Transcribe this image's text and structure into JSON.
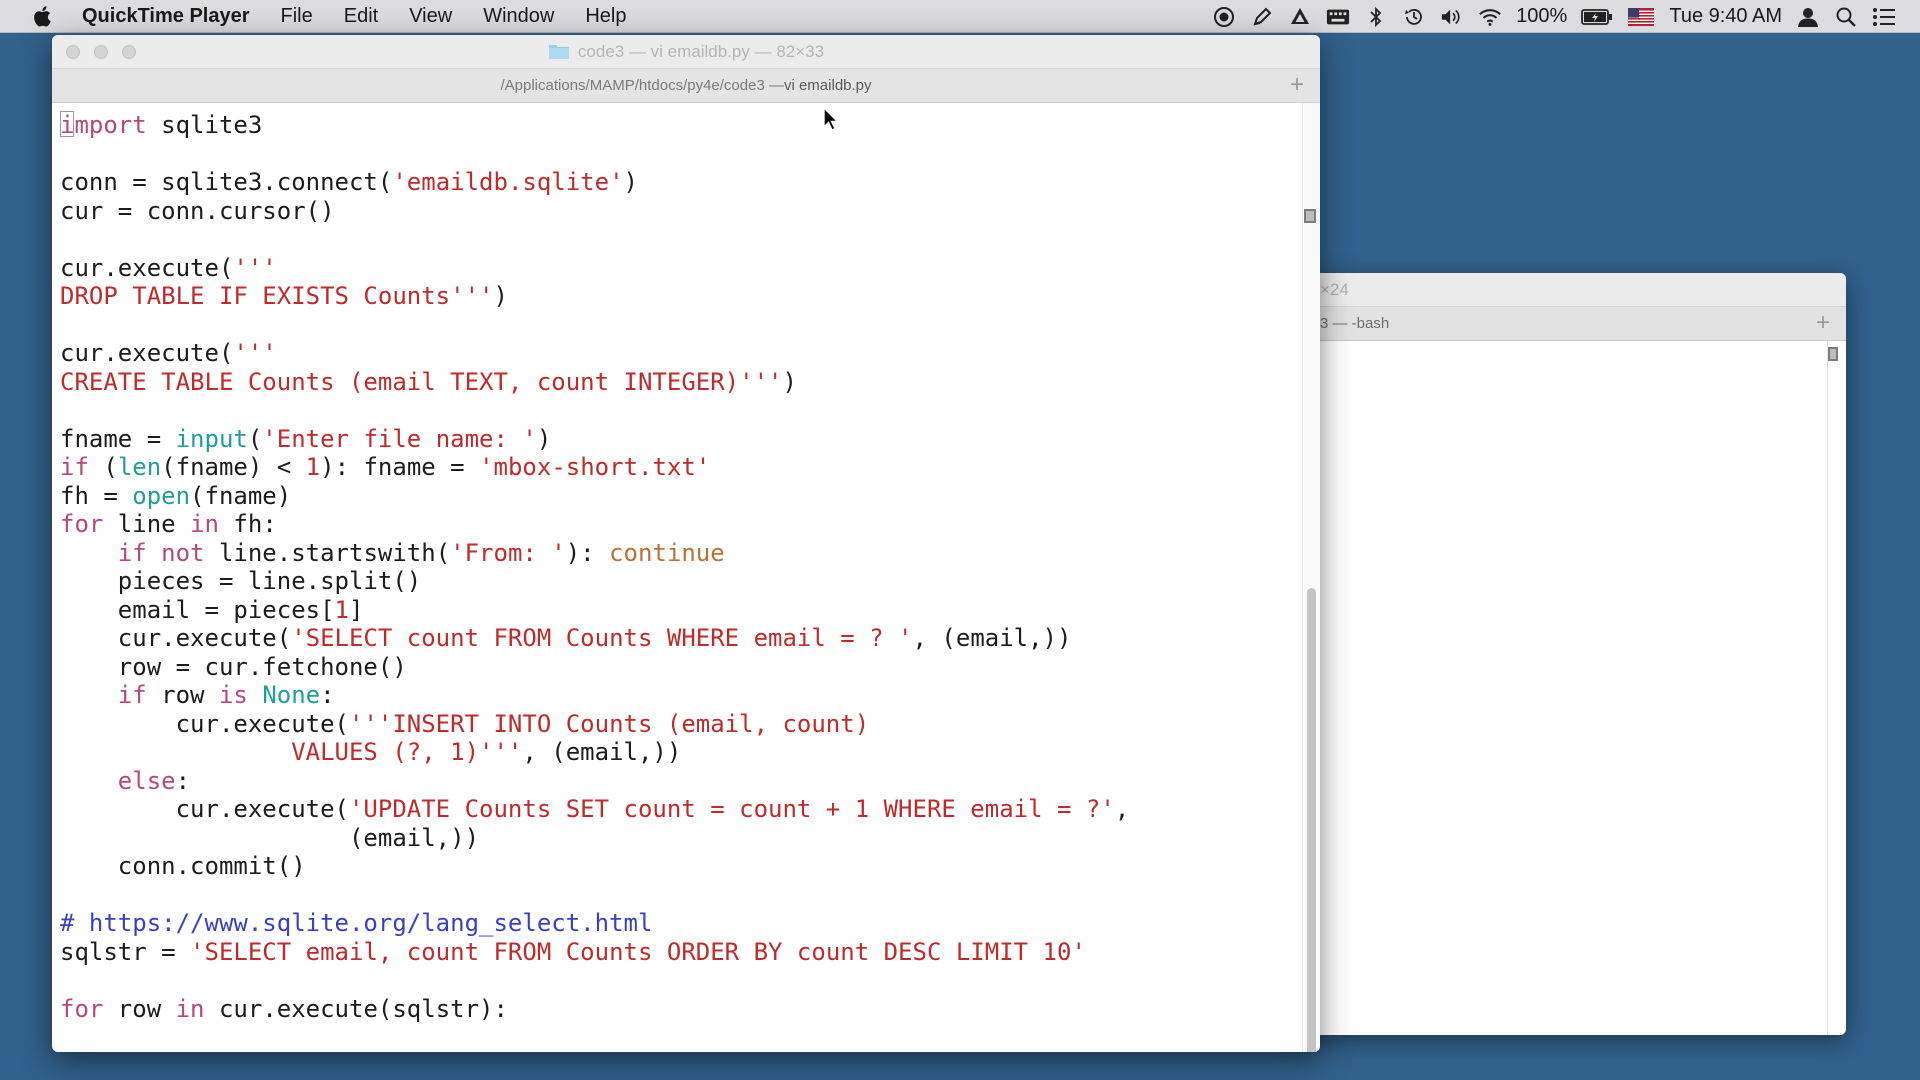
{
  "menubar": {
    "app_name": "QuickTime Player",
    "items": [
      {
        "label": "File"
      },
      {
        "label": "Edit"
      },
      {
        "label": "View"
      },
      {
        "label": "Window"
      },
      {
        "label": "Help"
      }
    ],
    "battery": "100%",
    "clock": "Tue 9:40 AM",
    "status_icons": [
      "record-icon",
      "pen-icon",
      "drive-icon",
      "keyboard-icon",
      "bluetooth-icon",
      "time-machine-icon",
      "volume-icon",
      "wifi-icon",
      "battery-icon",
      "flag-icon",
      "user-icon",
      "spotlight-icon",
      "notification-icon"
    ]
  },
  "front_window": {
    "title": "code3 — vi emaildb.py — 82×33",
    "tab_path": "/Applications/MAMP/htdocs/py4e/code3 — ",
    "tab_file": "vi emaildb.py"
  },
  "back_window": {
    "title": "×24",
    "tab_label": "3 — -bash"
  },
  "editor": {
    "lines": [
      [
        {
          "t": "i",
          "c": "cursorchar"
        },
        {
          "t": "mport",
          "c": "kw"
        },
        {
          "t": " sqlite3",
          "c": ""
        }
      ],
      [],
      [
        {
          "t": "conn = sqlite3.connect(",
          "c": ""
        },
        {
          "t": "'emaildb.sqlite'",
          "c": "str"
        },
        {
          "t": ")",
          "c": ""
        }
      ],
      [
        {
          "t": "cur = conn.cursor()",
          "c": ""
        }
      ],
      [],
      [
        {
          "t": "cur.execute(",
          "c": ""
        },
        {
          "t": "'''",
          "c": "str"
        }
      ],
      [
        {
          "t": "DROP TABLE IF EXISTS Counts'''",
          "c": "str"
        },
        {
          "t": ")",
          "c": ""
        }
      ],
      [],
      [
        {
          "t": "cur.execute(",
          "c": ""
        },
        {
          "t": "'''",
          "c": "str"
        }
      ],
      [
        {
          "t": "CREATE TABLE Counts (email TEXT, count INTEGER)'''",
          "c": "str"
        },
        {
          "t": ")",
          "c": ""
        }
      ],
      [],
      [
        {
          "t": "fname = ",
          "c": ""
        },
        {
          "t": "input",
          "c": "bi"
        },
        {
          "t": "(",
          "c": ""
        },
        {
          "t": "'Enter file name: '",
          "c": "str"
        },
        {
          "t": ")",
          "c": ""
        }
      ],
      [
        {
          "t": "if",
          "c": "kw"
        },
        {
          "t": " (",
          "c": ""
        },
        {
          "t": "len",
          "c": "bi"
        },
        {
          "t": "(fname) < ",
          "c": ""
        },
        {
          "t": "1",
          "c": "num"
        },
        {
          "t": "): fname = ",
          "c": ""
        },
        {
          "t": "'mbox-short.txt'",
          "c": "str"
        }
      ],
      [
        {
          "t": "fh = ",
          "c": ""
        },
        {
          "t": "open",
          "c": "bi"
        },
        {
          "t": "(fname)",
          "c": ""
        }
      ],
      [
        {
          "t": "for",
          "c": "kw"
        },
        {
          "t": " line ",
          "c": ""
        },
        {
          "t": "in",
          "c": "kw"
        },
        {
          "t": " fh:",
          "c": ""
        }
      ],
      [
        {
          "t": "    ",
          "c": ""
        },
        {
          "t": "if not",
          "c": "kw"
        },
        {
          "t": " line.startswith(",
          "c": ""
        },
        {
          "t": "'From: '",
          "c": "str"
        },
        {
          "t": "): ",
          "c": ""
        },
        {
          "t": "continue",
          "c": "ctl"
        }
      ],
      [
        {
          "t": "    pieces = line.split()",
          "c": ""
        }
      ],
      [
        {
          "t": "    email = pieces[",
          "c": ""
        },
        {
          "t": "1",
          "c": "num"
        },
        {
          "t": "]",
          "c": ""
        }
      ],
      [
        {
          "t": "    cur.execute(",
          "c": ""
        },
        {
          "t": "'SELECT count FROM Counts WHERE email = ? '",
          "c": "str"
        },
        {
          "t": ", (email,))",
          "c": ""
        }
      ],
      [
        {
          "t": "    row = cur.fetchone()",
          "c": ""
        }
      ],
      [
        {
          "t": "    ",
          "c": ""
        },
        {
          "t": "if",
          "c": "kw"
        },
        {
          "t": " row ",
          "c": ""
        },
        {
          "t": "is",
          "c": "kw"
        },
        {
          "t": " ",
          "c": ""
        },
        {
          "t": "None",
          "c": "bi"
        },
        {
          "t": ":",
          "c": ""
        }
      ],
      [
        {
          "t": "        cur.execute(",
          "c": ""
        },
        {
          "t": "'''INSERT INTO Counts (email, count)",
          "c": "str"
        }
      ],
      [
        {
          "t": "                ",
          "c": ""
        },
        {
          "t": "VALUES (?, 1)'''",
          "c": "str"
        },
        {
          "t": ", (email,))",
          "c": ""
        }
      ],
      [
        {
          "t": "    ",
          "c": ""
        },
        {
          "t": "else",
          "c": "kw"
        },
        {
          "t": ":",
          "c": ""
        }
      ],
      [
        {
          "t": "        cur.execute(",
          "c": ""
        },
        {
          "t": "'UPDATE Counts SET count = count + 1 WHERE email = ?'",
          "c": "str"
        },
        {
          "t": ",",
          "c": ""
        }
      ],
      [
        {
          "t": "                    (email,))",
          "c": ""
        }
      ],
      [
        {
          "t": "    conn.commit()",
          "c": ""
        }
      ],
      [],
      [
        {
          "t": "# https://www.sqlite.org/lang_select.html",
          "c": "com"
        }
      ],
      [
        {
          "t": "sqlstr = ",
          "c": ""
        },
        {
          "t": "'SELECT email, count FROM Counts ORDER BY count DESC LIMIT 10'",
          "c": "str"
        }
      ],
      [],
      [
        {
          "t": "for",
          "c": "kw"
        },
        {
          "t": " row ",
          "c": ""
        },
        {
          "t": "in",
          "c": "kw"
        },
        {
          "t": " cur.execute(sqlstr):",
          "c": ""
        }
      ]
    ]
  },
  "colors": {
    "desktop": "#31618c",
    "keyword": "#b5487f",
    "string": "#bf2a2a",
    "builtin": "#1e9e9c",
    "comment": "#3b3fc6",
    "continue": "#b87333"
  }
}
